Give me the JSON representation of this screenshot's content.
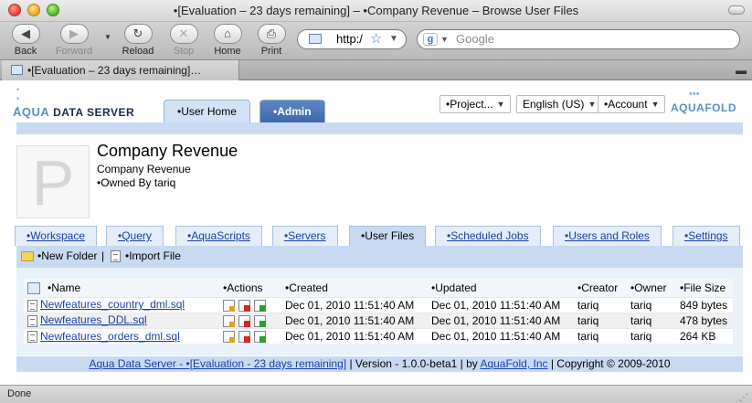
{
  "window": {
    "title": "•[Evaluation – 23 days remaining] – •Company Revenue – Browse User Files"
  },
  "toolbar": {
    "back": "Back",
    "forward": "Forward",
    "reload": "Reload",
    "stop": "Stop",
    "home": "Home",
    "print": "Print",
    "url": "http:/",
    "search_placeholder": "Google"
  },
  "browser_tab": {
    "label": "•[Evaluation – 23 days remaining]…"
  },
  "header": {
    "logo_aqua": "AQUA",
    "logo_ds": " DATA SERVER",
    "tab_user_home": "•User Home",
    "tab_admin": "•Admin",
    "project_select": "•Project...",
    "language_select": "English (US)",
    "account_select": "•Account",
    "aquafold_logo": "AQUAFOLD"
  },
  "project": {
    "avatar_letter": "P",
    "title": "Company Revenue",
    "subtitle": "Company Revenue",
    "owner": "•Owned By tariq"
  },
  "subtabs": [
    "•Workspace",
    "•Query",
    "•AquaScripts",
    "•Servers",
    "•User Files",
    "•Scheduled Jobs",
    "•Users and Roles",
    "•Settings"
  ],
  "actions": {
    "new_folder": "•New Folder",
    "separator": "|",
    "import_file": "•Import File"
  },
  "table": {
    "columns": [
      "•Name",
      "•Actions",
      "•Created",
      "•Updated",
      "•Creator",
      "•Owner",
      "•File Size"
    ],
    "rows": [
      {
        "name": "Newfeatures_country_dml.sql",
        "created": "Dec 01, 2010 11:51:40 AM",
        "updated": "Dec 01, 2010 11:51:40 AM",
        "creator": "tariq",
        "owner": "tariq",
        "size": "849 bytes"
      },
      {
        "name": "Newfeatures_DDL.sql",
        "created": "Dec 01, 2010 11:51:40 AM",
        "updated": "Dec 01, 2010 11:51:40 AM",
        "creator": "tariq",
        "owner": "tariq",
        "size": "478 bytes"
      },
      {
        "name": "Newfeatures_orders_dml.sql",
        "created": "Dec 01, 2010 11:51:40 AM",
        "updated": "Dec 01, 2010 11:51:40 AM",
        "creator": "tariq",
        "owner": "tariq",
        "size": "264 KB"
      }
    ]
  },
  "footer": {
    "product_link": "Aqua Data Server - •[Evaluation - 23 days remaining]",
    "version": " | Version - 1.0.0-beta1 | by ",
    "company_link": "AquaFold, Inc",
    "copyright": " | Copyright © 2009-2010"
  },
  "status": {
    "text": "Done"
  }
}
